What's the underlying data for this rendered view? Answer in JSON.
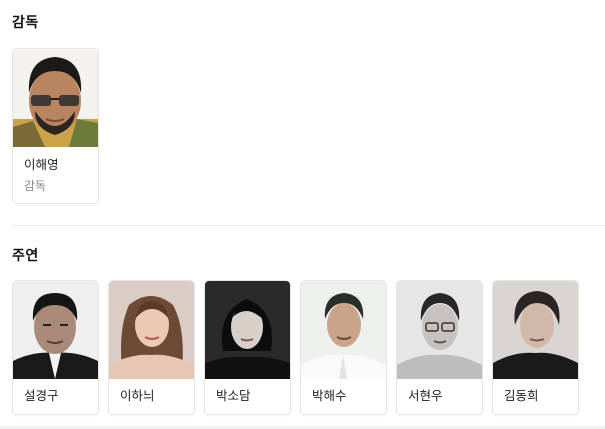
{
  "director_section": {
    "title": "감독",
    "people": [
      {
        "name": "이해영",
        "role": "감독"
      }
    ]
  },
  "cast_section": {
    "title": "주연",
    "people": [
      {
        "name": "설경구"
      },
      {
        "name": "이하늬"
      },
      {
        "name": "박소담"
      },
      {
        "name": "박해수"
      },
      {
        "name": "서현우"
      },
      {
        "name": "김동희"
      }
    ]
  }
}
